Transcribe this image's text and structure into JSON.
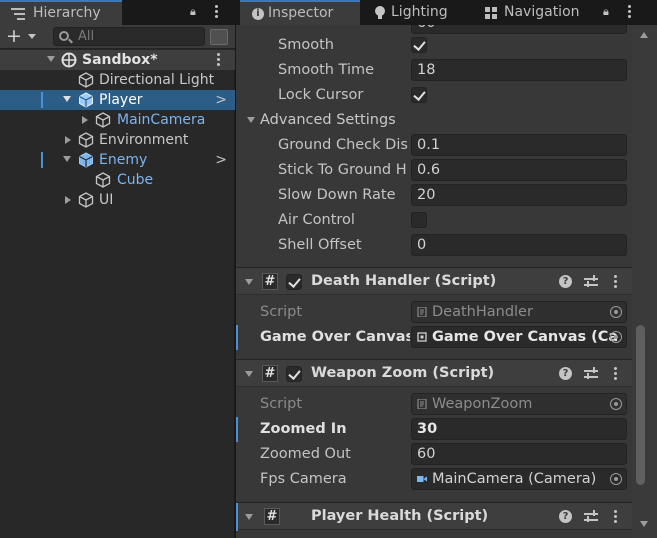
{
  "hierarchy": {
    "tab_label": "Hierarchy",
    "search_placeholder": "All",
    "add_label": "+",
    "items": [
      {
        "label": "Sandbox*",
        "kind": "scene"
      },
      {
        "label": "Directional Light"
      },
      {
        "label": "Player",
        "selected": true
      },
      {
        "label": "MainCamera",
        "prefab": true
      },
      {
        "label": "Environment"
      },
      {
        "label": "Enemy",
        "prefab": true
      },
      {
        "label": "Cube",
        "prefab": true
      },
      {
        "label": "UI"
      }
    ]
  },
  "inspector": {
    "tabs": {
      "inspector": "Inspector",
      "lighting": "Lighting",
      "navigation": "Navigation"
    },
    "partial_field_value": "60",
    "props": {
      "smooth": {
        "label": "Smooth",
        "checked": true
      },
      "smooth_time": {
        "label": "Smooth Time",
        "value": "18"
      },
      "lock_cursor": {
        "label": "Lock Cursor",
        "checked": true
      }
    },
    "advanced": {
      "title": "Advanced Settings",
      "ground_check": {
        "label": "Ground Check Dis",
        "value": "0.1"
      },
      "stick_to_ground": {
        "label": "Stick To Ground H",
        "value": "0.6"
      },
      "slow_down_rate": {
        "label": "Slow Down Rate",
        "value": "20"
      },
      "air_control": {
        "label": "Air Control",
        "checked": false
      },
      "shell_offset": {
        "label": "Shell Offset",
        "value": "0"
      }
    },
    "death_handler": {
      "title": "Death Handler (Script)",
      "script_label": "Script",
      "script_value": "DeathHandler",
      "canvas_label": "Game Over Canvas",
      "canvas_value": "Game Over Canvas (Ca"
    },
    "weapon_zoom": {
      "title": "Weapon Zoom (Script)",
      "script_label": "Script",
      "script_value": "WeaponZoom",
      "zoomed_in": {
        "label": "Zoomed In",
        "value": "30"
      },
      "zoomed_out": {
        "label": "Zoomed Out",
        "value": "60"
      },
      "fps_camera": {
        "label": "Fps Camera",
        "value": "MainCamera (Camera)"
      }
    },
    "player_health": {
      "title": "Player Health (Script)"
    }
  },
  "colors": {
    "selection": "#2c5d87",
    "prefab_text": "#7cb4ee",
    "tab_accent": "#3a79bb",
    "modified_marker": "#4a90d8"
  }
}
